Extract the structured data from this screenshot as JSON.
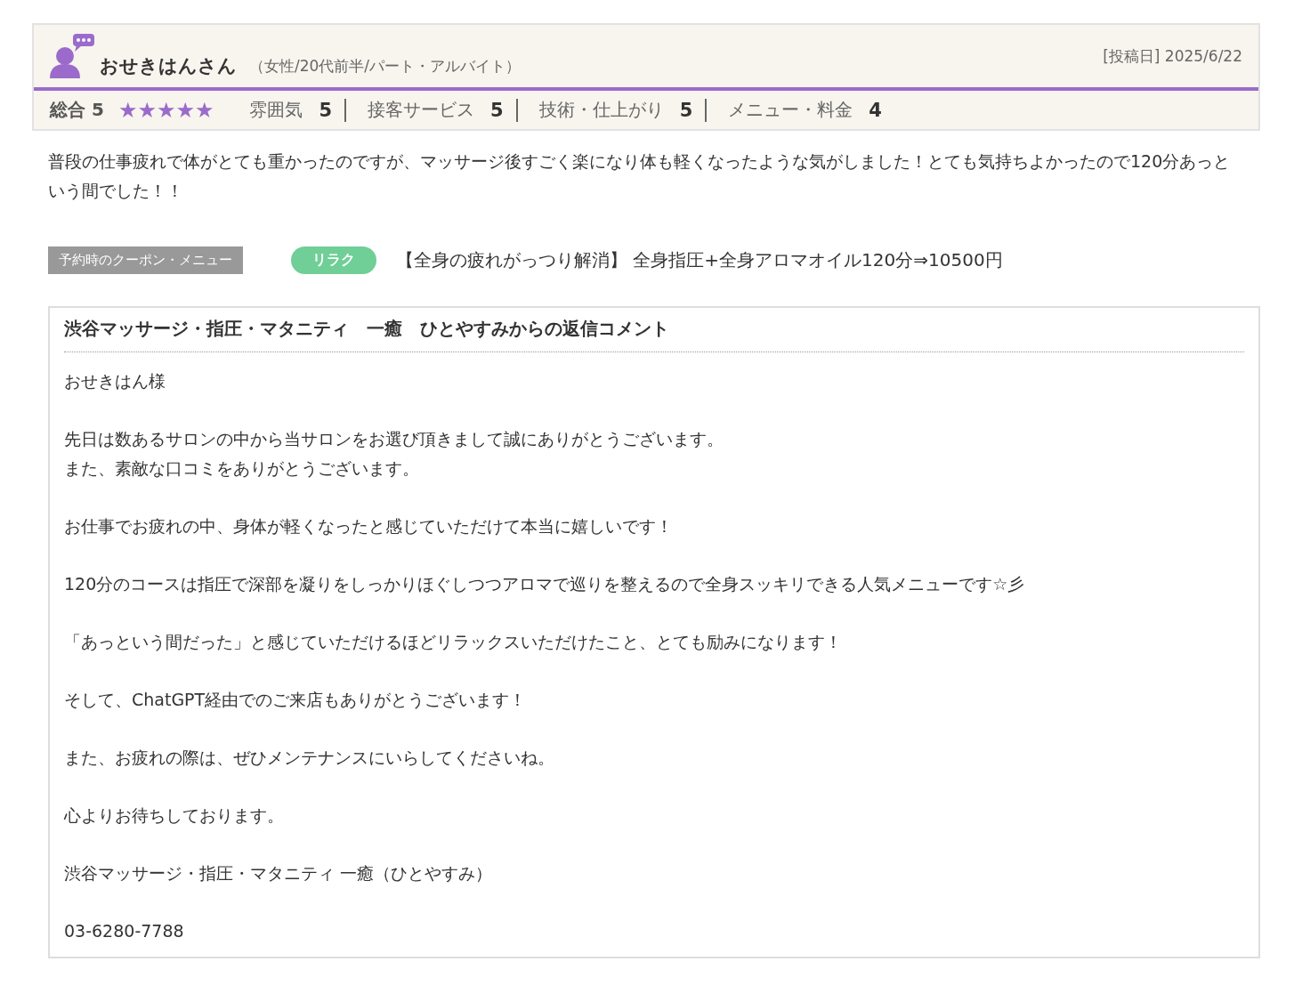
{
  "review": {
    "name": "おせきはんさん",
    "profile": "（女性/20代前半/パート・アルバイト）",
    "posted": "[投稿日] 2025/6/22",
    "overall": {
      "label": "総合",
      "score": "5",
      "stars": 5
    },
    "ratings": [
      {
        "label": "雰囲気",
        "score": "5"
      },
      {
        "label": "接客サービス",
        "score": "5"
      },
      {
        "label": "技術・仕上がり",
        "score": "5"
      },
      {
        "label": "メニュー・料金",
        "score": "4"
      }
    ],
    "body": "普段の仕事疲れで体がとても重かったのですが、マッサージ後すごく楽になり体も軽くなったような気がしました！とても気持ちよかったので120分あっという間でした！！",
    "coupon": {
      "heading": "予約時のクーポン・メニュー",
      "tag": "リラク",
      "text": "【全身の疲れがっつり解消】 全身指圧+全身アロマオイル120分⇒10500円"
    }
  },
  "reply": {
    "title": "渋谷マッサージ・指圧・マタニティ　一癒　ひとやすみからの返信コメント",
    "paragraphs": [
      "おせきはん様",
      [
        "先日は数あるサロンの中から当サロンをお選び頂きまして誠にありがとうございます。",
        "また、素敵な口コミをありがとうございます。"
      ],
      "お仕事でお疲れの中、身体が軽くなったと感じていただけて本当に嬉しいです！",
      "120分のコースは指圧で深部を凝りをしっかりほぐしつつアロマで巡りを整えるので全身スッキリできる人気メニューです☆彡",
      "「あっという間だった」と感じていただけるほどリラックスいただけたこと、とても励みになります！",
      "そして、ChatGPT経由でのご来店もありがとうございます！",
      "また、お疲れの際は、ぜひメンテナンスにいらしてくださいね。",
      "心よりお待ちしております。",
      "渋谷マッサージ・指圧・マタニティ 一癒（ひとやすみ）",
      "03-6280-7788"
    ]
  }
}
